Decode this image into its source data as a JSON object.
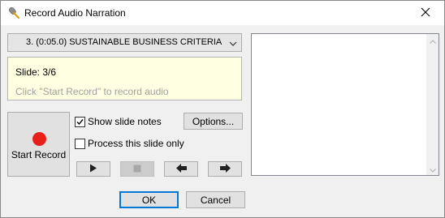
{
  "window": {
    "title": "Record Audio Narration",
    "icon": "microphone-icon",
    "close_icon": "close-icon"
  },
  "slide_select": {
    "value": "3. (0:05.0) SUSTAINABLE BUSINESS CRITERIA",
    "icon": "chevron-down-icon"
  },
  "info": {
    "slide_label": "Slide: 3/6",
    "hint": "Click \"Start Record\" to record audio"
  },
  "record": {
    "label": "Start Record",
    "icon": "record-dot-icon",
    "color": "#e8201c"
  },
  "options": {
    "show_notes_label": "Show slide notes",
    "show_notes_checked": true,
    "process_only_label": "Process this slide only",
    "process_only_checked": false,
    "options_button": "Options..."
  },
  "media_controls": {
    "play_icon": "play-icon",
    "stop_icon": "stop-icon",
    "prev_icon": "arrow-left-icon",
    "next_icon": "arrow-right-icon"
  },
  "footer": {
    "ok": "OK",
    "cancel": "Cancel"
  },
  "colors": {
    "accent": "#0078d7",
    "info_background": "#ffffe1"
  }
}
